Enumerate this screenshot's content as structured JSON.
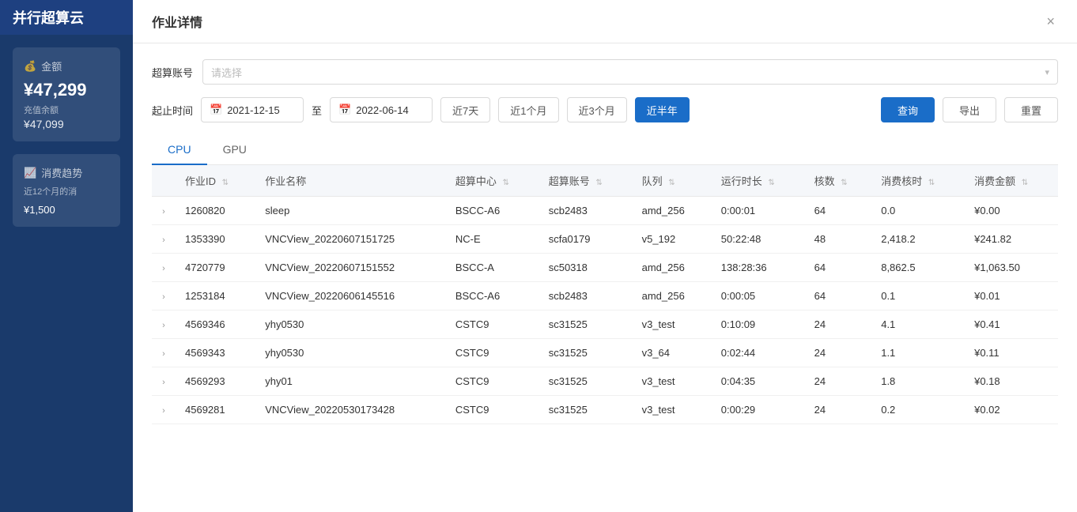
{
  "sidebar": {
    "logo": "并行超算云",
    "balance_card": {
      "title": "金额",
      "amount": "¥47,299",
      "sub_label": "充值余额",
      "sub_amount": "¥47,099",
      "plus_icon": "+"
    },
    "trend_card": {
      "title": "消费趋势",
      "sub": "近12个月的消",
      "amount": "¥1,500"
    }
  },
  "modal": {
    "title": "作业详情",
    "close_label": "×",
    "filter": {
      "label": "超算账号",
      "placeholder": "请选择"
    },
    "date_filter": {
      "label": "起止时间",
      "start": "2021-12-15",
      "end": "2022-06-14",
      "separator": "至",
      "quick_buttons": [
        "近7天",
        "近1个月",
        "近3个月",
        "近半年"
      ],
      "active_button": "近半年"
    },
    "action_buttons": {
      "query": "查询",
      "export": "导出",
      "reset": "重置"
    },
    "tabs": [
      {
        "label": "CPU",
        "active": true
      },
      {
        "label": "GPU",
        "active": false
      }
    ],
    "table": {
      "columns": [
        {
          "key": "expand",
          "label": ""
        },
        {
          "key": "job_id",
          "label": "作业ID"
        },
        {
          "key": "job_name",
          "label": "作业名称"
        },
        {
          "key": "hpc_center",
          "label": "超算中心"
        },
        {
          "key": "hpc_account",
          "label": "超算账号"
        },
        {
          "key": "queue",
          "label": "队列"
        },
        {
          "key": "run_time",
          "label": "运行时长"
        },
        {
          "key": "cores",
          "label": "核数"
        },
        {
          "key": "core_hours",
          "label": "消费核时"
        },
        {
          "key": "cost",
          "label": "消费金额"
        }
      ],
      "rows": [
        {
          "expand": ">",
          "job_id": "1260820",
          "job_name": "sleep",
          "hpc_center": "BSCC-A6",
          "hpc_account": "scb2483",
          "queue": "amd_256",
          "run_time": "0:00:01",
          "cores": "64",
          "core_hours": "0.0",
          "cost": "¥0.00"
        },
        {
          "expand": ">",
          "job_id": "1353390",
          "job_name": "VNCView_20220607151725",
          "hpc_center": "NC-E",
          "hpc_account": "scfa0179",
          "queue": "v5_192",
          "run_time": "50:22:48",
          "cores": "48",
          "core_hours": "2,418.2",
          "cost": "¥241.82"
        },
        {
          "expand": ">",
          "job_id": "4720779",
          "job_name": "VNCView_20220607151552",
          "hpc_center": "BSCC-A",
          "hpc_account": "sc50318",
          "queue": "amd_256",
          "run_time": "138:28:36",
          "cores": "64",
          "core_hours": "8,862.5",
          "cost": "¥1,063.50"
        },
        {
          "expand": ">",
          "job_id": "1253184",
          "job_name": "VNCView_20220606145516",
          "hpc_center": "BSCC-A6",
          "hpc_account": "scb2483",
          "queue": "amd_256",
          "run_time": "0:00:05",
          "cores": "64",
          "core_hours": "0.1",
          "cost": "¥0.01"
        },
        {
          "expand": ">",
          "job_id": "4569346",
          "job_name": "yhy0530",
          "hpc_center": "CSTC9",
          "hpc_account": "sc31525",
          "queue": "v3_test",
          "run_time": "0:10:09",
          "cores": "24",
          "core_hours": "4.1",
          "cost": "¥0.41"
        },
        {
          "expand": ">",
          "job_id": "4569343",
          "job_name": "yhy0530",
          "hpc_center": "CSTC9",
          "hpc_account": "sc31525",
          "queue": "v3_64",
          "run_time": "0:02:44",
          "cores": "24",
          "core_hours": "1.1",
          "cost": "¥0.11"
        },
        {
          "expand": ">",
          "job_id": "4569293",
          "job_name": "yhy01",
          "hpc_center": "CSTC9",
          "hpc_account": "sc31525",
          "queue": "v3_test",
          "run_time": "0:04:35",
          "cores": "24",
          "core_hours": "1.8",
          "cost": "¥0.18"
        },
        {
          "expand": ">",
          "job_id": "4569281",
          "job_name": "VNCView_20220530173428",
          "hpc_center": "CSTC9",
          "hpc_account": "sc31525",
          "queue": "v3_test",
          "run_time": "0:00:29",
          "cores": "24",
          "core_hours": "0.2",
          "cost": "¥0.02"
        }
      ]
    }
  }
}
